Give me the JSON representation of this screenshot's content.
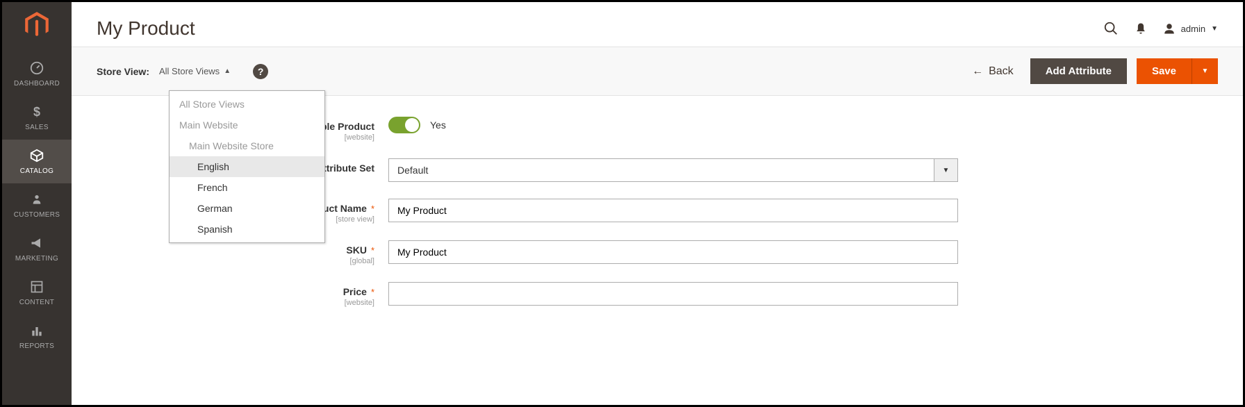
{
  "sidebar": {
    "items": [
      {
        "label": "DASHBOARD"
      },
      {
        "label": "SALES"
      },
      {
        "label": "CATALOG"
      },
      {
        "label": "CUSTOMERS"
      },
      {
        "label": "MARKETING"
      },
      {
        "label": "CONTENT"
      },
      {
        "label": "REPORTS"
      }
    ]
  },
  "header": {
    "title": "My Product",
    "admin_label": "admin"
  },
  "toolbar": {
    "store_view_label": "Store View:",
    "store_view_current": "All Store Views",
    "back_label": "Back",
    "add_attribute_label": "Add Attribute",
    "save_label": "Save"
  },
  "store_view_dropdown": {
    "items": [
      {
        "label": "All Store Views",
        "level": 0
      },
      {
        "label": "Main Website",
        "level": 0
      },
      {
        "label": "Main Website Store",
        "level": 1
      },
      {
        "label": "English",
        "level": 2,
        "selected": true
      },
      {
        "label": "French",
        "level": 2
      },
      {
        "label": "German",
        "level": 2
      },
      {
        "label": "Spanish",
        "level": 2
      }
    ]
  },
  "form": {
    "enable_product": {
      "label": "Enable Product",
      "scope": "[website]",
      "toggle_text": "Yes"
    },
    "attribute_set": {
      "label": "Attribute Set",
      "value": "Default"
    },
    "product_name": {
      "label": "Product Name",
      "scope": "[store view]",
      "value": "My Product"
    },
    "sku": {
      "label": "SKU",
      "scope": "[global]",
      "value": "My Product"
    },
    "price": {
      "label": "Price",
      "scope": "[website]",
      "value": ""
    }
  }
}
